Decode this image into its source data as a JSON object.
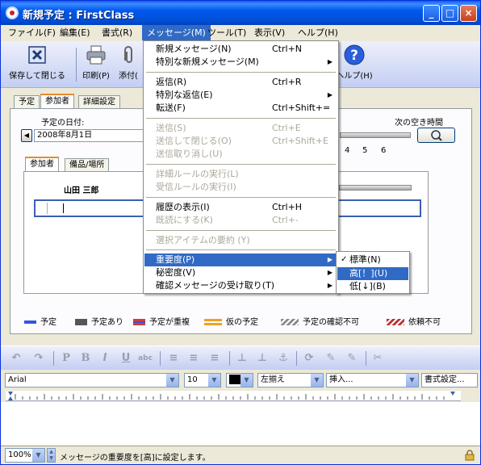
{
  "window": {
    "title": "新規予定 : FirstClass",
    "controls": [
      "_",
      "□",
      "×"
    ]
  },
  "menubar": [
    "ファイル(F)",
    "編集(E)",
    "書式(R)",
    "メッセージ(M)",
    "ツール(T)",
    "表示(V)",
    "ヘルプ(H)"
  ],
  "toolbar": {
    "save_close": "保存して閉じる",
    "print": "印刷(P)",
    "attach": "添付(",
    "help": "ヘルプ(H)"
  },
  "tabs": [
    "予定",
    "参加者",
    "詳細設定"
  ],
  "schedule": {
    "date_label": "予定の日付:",
    "date_value": "2008年8月1日",
    "next_free_label": "次の空き時間",
    "hours": [
      "4",
      "5",
      "6"
    ]
  },
  "inner_tabs": [
    "参加者",
    "備品/場所"
  ],
  "participant": {
    "name": "山田 三郎"
  },
  "legend": [
    {
      "label": "予定",
      "color": "#3355dd"
    },
    {
      "label": "予定あり",
      "color": "#555555"
    },
    {
      "label": "予定が重複",
      "color": "#d63a3a"
    },
    {
      "label": "仮の予定",
      "color": "#f0a020"
    },
    {
      "label": "予定の確認不可",
      "color": "#8a8a8a"
    },
    {
      "label": "依頼不可",
      "color": "#c03030"
    }
  ],
  "message_menu": {
    "items": [
      {
        "label": "新規メッセージ(N)",
        "shortcut": "Ctrl+N",
        "disabled": false,
        "submenu": false
      },
      {
        "label": "特別な新規メッセージ(M)",
        "shortcut": "",
        "disabled": false,
        "submenu": true
      },
      {
        "label": "返信(R)",
        "shortcut": "Ctrl+R",
        "disabled": false,
        "submenu": false
      },
      {
        "label": "特別な返信(E)",
        "shortcut": "",
        "disabled": false,
        "submenu": true
      },
      {
        "label": "転送(F)",
        "shortcut": "Ctrl+Shift+=",
        "disabled": false,
        "submenu": false
      },
      {
        "label": "送信(S)",
        "shortcut": "Ctrl+E",
        "disabled": true,
        "submenu": false
      },
      {
        "label": "送信して閉じる(O)",
        "shortcut": "Ctrl+Shift+E",
        "disabled": true,
        "submenu": false
      },
      {
        "label": "送信取り消し(U)",
        "shortcut": "",
        "disabled": true,
        "submenu": false
      },
      {
        "label": "詳細ルールの実行(L)",
        "shortcut": "",
        "disabled": true,
        "submenu": false
      },
      {
        "label": "受信ルールの実行(I)",
        "shortcut": "",
        "disabled": true,
        "submenu": false
      },
      {
        "label": "履歴の表示(I)",
        "shortcut": "Ctrl+H",
        "disabled": false,
        "submenu": false
      },
      {
        "label": "既読にする(K)",
        "shortcut": "Ctrl+-",
        "disabled": true,
        "submenu": false
      },
      {
        "label": "選択アイテムの要約 (Y)",
        "shortcut": "",
        "disabled": true,
        "submenu": false
      },
      {
        "label": "重要度(P)",
        "shortcut": "",
        "disabled": false,
        "submenu": true
      },
      {
        "label": "秘密度(V)",
        "shortcut": "",
        "disabled": false,
        "submenu": true
      },
      {
        "label": "確認メッセージの受け取り(T)",
        "shortcut": "",
        "disabled": false,
        "submenu": true
      }
    ]
  },
  "priority_submenu": [
    {
      "label": "標準(N)",
      "checked": true
    },
    {
      "label": "高[！](U)",
      "checked": false
    },
    {
      "label": "低[↓](B)",
      "checked": false
    }
  ],
  "format": {
    "font": "Arial",
    "size": "10",
    "align": "左揃え",
    "insert": "挿入...",
    "style": "書式設定..."
  },
  "status": {
    "zoom": "100%",
    "message": "メッセージの重要度を[高]に設定します。"
  }
}
